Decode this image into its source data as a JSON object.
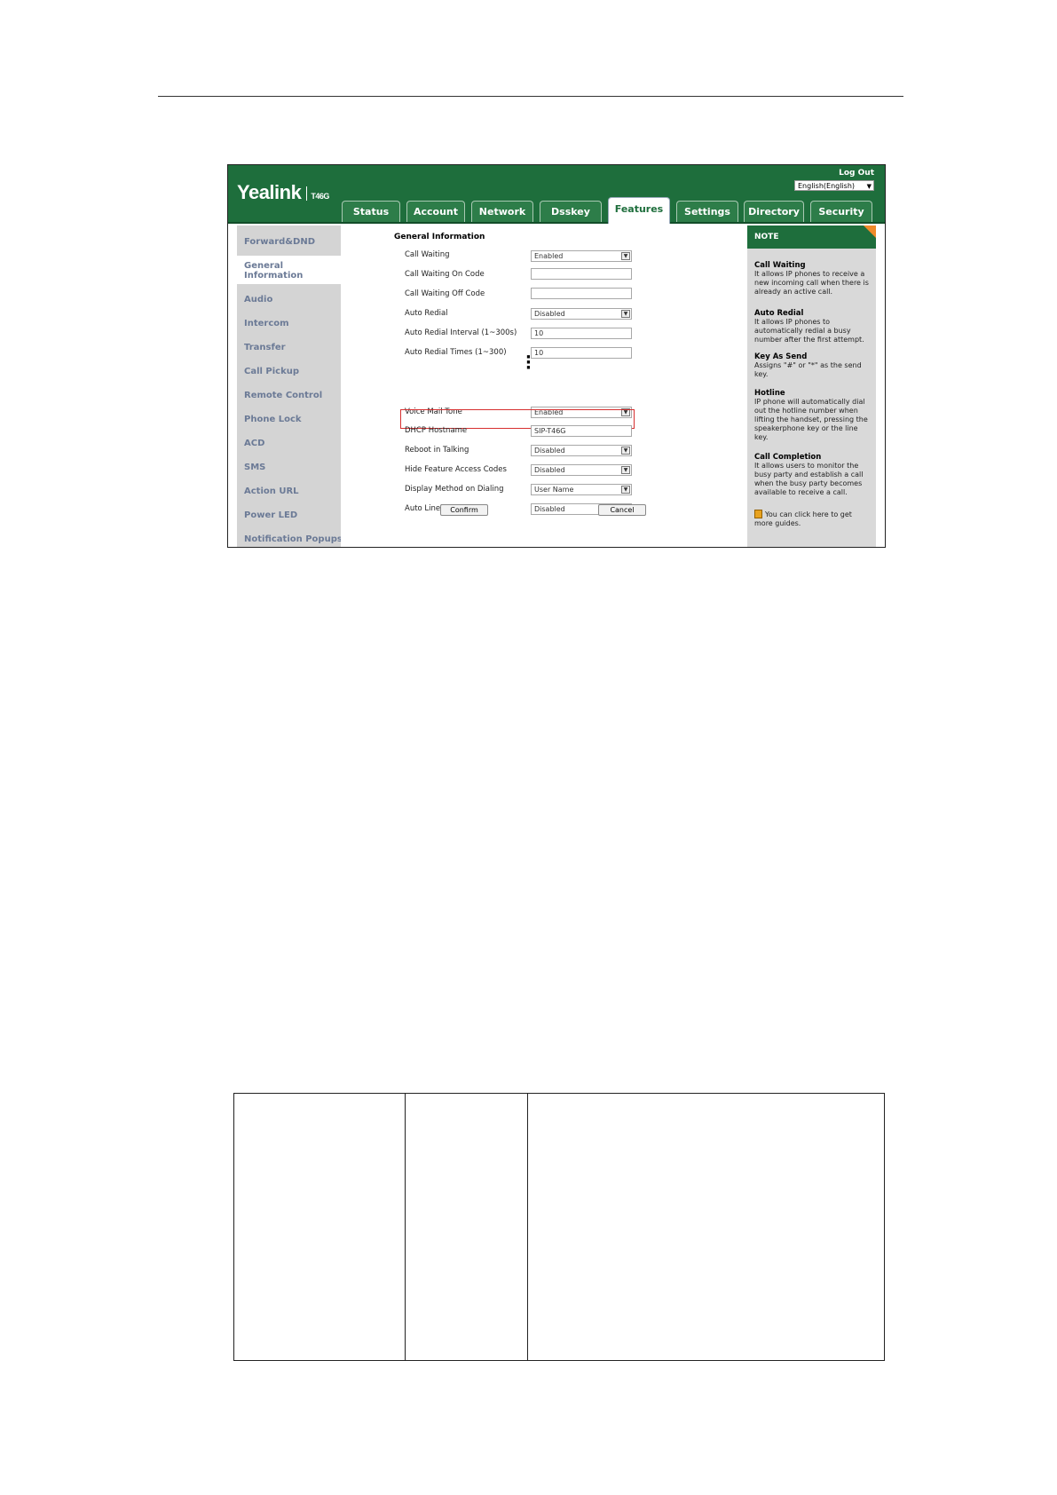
{
  "app": {
    "brand": "Yealink",
    "model": "T46G",
    "logout_label": "Log Out",
    "language": "English(English)",
    "accent_color": "#1e6e3c",
    "highlight_color": "#d62f2f"
  },
  "tabs": [
    {
      "label": "Status"
    },
    {
      "label": "Account"
    },
    {
      "label": "Network"
    },
    {
      "label": "Dsskey"
    },
    {
      "label": "Features",
      "active": true
    },
    {
      "label": "Settings"
    },
    {
      "label": "Directory"
    },
    {
      "label": "Security"
    }
  ],
  "sidebar": {
    "items": [
      {
        "label": "Forward&DND"
      },
      {
        "label": "General Information",
        "line1": "General",
        "line2": "Information",
        "active": true
      },
      {
        "label": "Audio"
      },
      {
        "label": "Intercom"
      },
      {
        "label": "Transfer"
      },
      {
        "label": "Call Pickup"
      },
      {
        "label": "Remote Control"
      },
      {
        "label": "Phone Lock"
      },
      {
        "label": "ACD"
      },
      {
        "label": "SMS"
      },
      {
        "label": "Action URL"
      },
      {
        "label": "Power LED"
      },
      {
        "label": "Notification Popups"
      }
    ]
  },
  "form": {
    "section_title": "General Information",
    "fields": [
      {
        "label": "Call Waiting",
        "value": "Enabled",
        "type": "select"
      },
      {
        "label": "Call Waiting On Code",
        "value": "",
        "type": "text"
      },
      {
        "label": "Call Waiting Off Code",
        "value": "",
        "type": "text"
      },
      {
        "label": "Auto Redial",
        "value": "Disabled",
        "type": "select"
      },
      {
        "label": "Auto Redial Interval (1~300s)",
        "value": "10",
        "type": "text"
      },
      {
        "label": "Auto Redial Times (1~300)",
        "value": "10",
        "type": "text"
      },
      {
        "label": "Voice Mail Tone",
        "value": "Enabled",
        "type": "select"
      },
      {
        "label": "DHCP Hostname",
        "value": "SIP-T46G",
        "type": "text"
      },
      {
        "label": "Reboot in Talking",
        "value": "Disabled",
        "type": "select"
      },
      {
        "label": "Hide Feature Access Codes",
        "value": "Disabled",
        "type": "select"
      },
      {
        "label": "Display Method on Dialing",
        "value": "User Name",
        "type": "select"
      },
      {
        "label": "Auto Linekeys",
        "value": "Disabled",
        "type": "select"
      }
    ],
    "confirm_label": "Confirm",
    "cancel_label": "Cancel"
  },
  "note": {
    "title": "NOTE",
    "entries": [
      {
        "heading": "Call Waiting",
        "text": "It allows IP phones to receive a new incoming call when there is already an active call."
      },
      {
        "heading": "Auto Redial",
        "text": "It allows IP phones to automatically redial a busy number after the first attempt."
      },
      {
        "heading": "Key As Send",
        "text": "Assigns \"#\" or \"*\" as the send key."
      },
      {
        "heading": "Hotline",
        "text": "IP phone will automatically dial out the hotline number when lifting the handset, pressing the speakerphone key or the line key."
      },
      {
        "heading": "Call Completion",
        "text": "It allows users to monitor the busy party and establish a call when the busy party becomes available to receive a call."
      }
    ],
    "guide_text": "You can click here to get more guides."
  }
}
